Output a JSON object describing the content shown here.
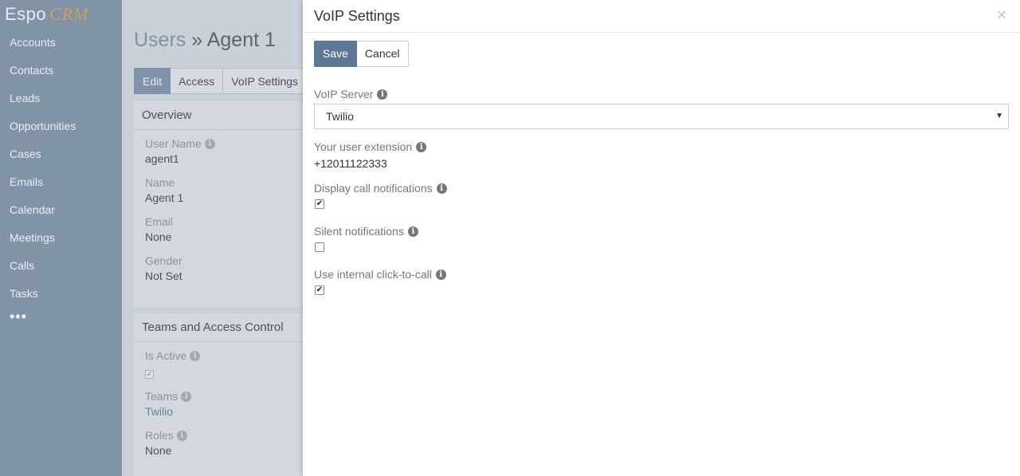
{
  "logo": {
    "espo": "Espo",
    "crm": "CRM"
  },
  "sidebar": {
    "items": [
      {
        "label": "Accounts"
      },
      {
        "label": "Contacts"
      },
      {
        "label": "Leads"
      },
      {
        "label": "Opportunities"
      },
      {
        "label": "Cases"
      },
      {
        "label": "Emails"
      },
      {
        "label": "Calendar"
      },
      {
        "label": "Meetings"
      },
      {
        "label": "Calls"
      },
      {
        "label": "Tasks"
      }
    ],
    "more": "•••"
  },
  "header": {
    "crumb": "Users",
    "sep": " » ",
    "title": "Agent 1"
  },
  "tabs": [
    {
      "label": "Edit"
    },
    {
      "label": "Access"
    },
    {
      "label": "VoIP Settings"
    }
  ],
  "overview": {
    "title": "Overview",
    "fields": [
      {
        "label": "User Name",
        "value": "agent1"
      },
      {
        "label": "Name",
        "value": "Agent 1"
      },
      {
        "label": "Email",
        "value": "None"
      },
      {
        "label": "Gender",
        "value": "Not Set"
      }
    ]
  },
  "teams_panel": {
    "title": "Teams and Access Control",
    "is_active_label": "Is Active",
    "is_active": true,
    "teams_label": "Teams",
    "teams_value": "Twilio",
    "roles_label": "Roles",
    "roles_value": "None"
  },
  "modal": {
    "title": "VoIP Settings",
    "close": "×",
    "save_label": "Save",
    "cancel_label": "Cancel",
    "voip_server_label": "VoIP Server",
    "voip_server_value": "Twilio",
    "extension_label": "Your user extension",
    "extension_value": "+12011122333",
    "display_notifications_label": "Display call notifications",
    "display_notifications": true,
    "silent_notifications_label": "Silent notifications",
    "silent_notifications": false,
    "click_to_call_label": "Use internal click-to-call",
    "click_to_call": true
  },
  "icons": {
    "info": "i",
    "check": "✔",
    "caret": "▼"
  },
  "colors": {
    "sidebar_bg": "#8193a6",
    "primary": "#5d7894",
    "logo_accent": "#c7a45a"
  }
}
